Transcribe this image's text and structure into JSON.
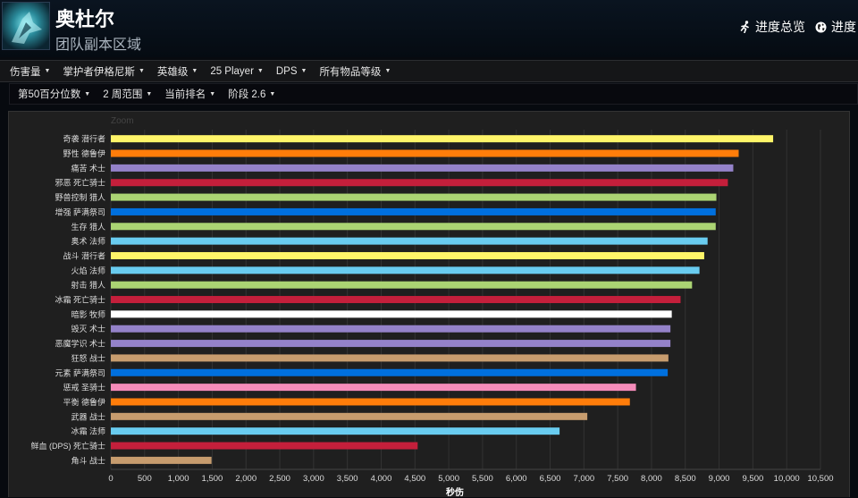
{
  "header": {
    "title": "奥杜尔",
    "subtitle": "团队副本区域",
    "nav_overview": "进度总览",
    "nav_progress": "进度"
  },
  "filters_top": [
    {
      "label": "伤害量"
    },
    {
      "label": "掌护者伊格尼斯"
    },
    {
      "label": "英雄级"
    },
    {
      "label": "25 Player"
    },
    {
      "label": "DPS"
    },
    {
      "label": "所有物品等级"
    }
  ],
  "filters_bottom": [
    {
      "label": "第50百分位数"
    },
    {
      "label": "2 周范围"
    },
    {
      "label": "当前排名"
    },
    {
      "label": "阶段 2.6"
    }
  ],
  "chart_data": {
    "type": "bar",
    "orientation": "horizontal",
    "title": "",
    "xlabel": "秒伤",
    "ylabel": "",
    "corner_label": "Zoom",
    "xlim": [
      0,
      10500
    ],
    "xticks": [
      0,
      500,
      1000,
      1500,
      2000,
      2500,
      3000,
      3500,
      4000,
      4500,
      5000,
      5500,
      6000,
      6500,
      7000,
      7500,
      8000,
      8500,
      9000,
      9500,
      10000,
      10500
    ],
    "xtick_labels": [
      "0",
      "500",
      "1,000",
      "1,500",
      "2,000",
      "2,500",
      "3,000",
      "3,500",
      "4,000",
      "4,500",
      "5,000",
      "5,500",
      "6,000",
      "6,500",
      "7,000",
      "7,500",
      "8,000",
      "8,500",
      "9,000",
      "9,500",
      "10,000",
      "10,500"
    ],
    "grid": true,
    "categories": [
      "奇袭 潜行者",
      "野性 德鲁伊",
      "痛苦 术士",
      "邪恶 死亡骑士",
      "野兽控制 猎人",
      "增强 萨满祭司",
      "生存 猎人",
      "奥术 法师",
      "战斗 潜行者",
      "火焰 法师",
      "射击 猎人",
      "冰霜 死亡骑士",
      "暗影 牧师",
      "毁灭 术士",
      "恶魔学识 术士",
      "狂怒 战士",
      "元素 萨满祭司",
      "惩戒 圣骑士",
      "平衡 德鲁伊",
      "武器 战士",
      "冰霜 法师",
      "鲜血 (DPS) 死亡骑士",
      "角斗 战士"
    ],
    "values": [
      9800,
      9290,
      9210,
      9130,
      8960,
      8950,
      8950,
      8830,
      8780,
      8710,
      8600,
      8430,
      8300,
      8280,
      8280,
      8250,
      8240,
      7770,
      7680,
      7050,
      6640,
      4540,
      1490
    ],
    "colors": [
      "#fff569",
      "#ff7d0a",
      "#9482c9",
      "#c41f3b",
      "#abd473",
      "#0070de",
      "#abd473",
      "#69ccf0",
      "#fff569",
      "#69ccf0",
      "#abd473",
      "#c41f3b",
      "#ffffff",
      "#9482c9",
      "#9482c9",
      "#c79c6e",
      "#0070de",
      "#f58cba",
      "#ff7d0a",
      "#c79c6e",
      "#69ccf0",
      "#c41f3b",
      "#c79c6e"
    ]
  }
}
